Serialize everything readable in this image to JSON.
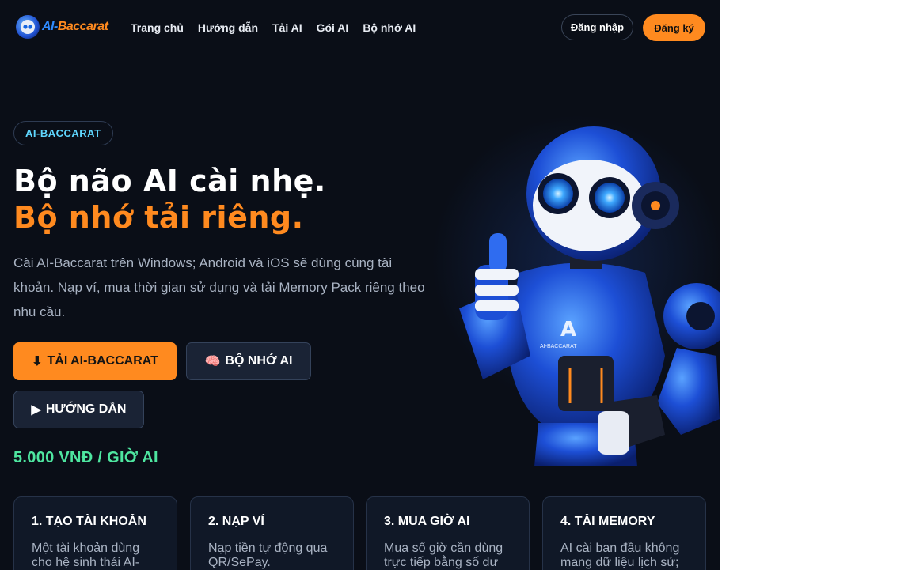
{
  "brand": {
    "logo_text": "AI-Baccarat",
    "accent": "#ff8a1f",
    "primary": "#2f8bff"
  },
  "nav": {
    "items": [
      "Trang chủ",
      "Hướng dẫn",
      "Tải AI",
      "Gói AI",
      "Bộ nhớ AI"
    ],
    "login": "Đăng nhập",
    "register": "Đăng ký"
  },
  "hero": {
    "pill": "AI-BACCARAT",
    "title_line1": "Bộ não AI cài nhẹ.",
    "title_line2": "Bộ nhớ tải riêng.",
    "description": "Cài AI-Baccarat trên Windows; Android và iOS sẽ dùng cùng tài khoản. Nạp ví, mua thời gian sử dụng và tải Memory Pack riêng theo nhu cầu.",
    "buttons": {
      "download": {
        "icon": "⬇",
        "label": "TẢI AI-BACCARAT"
      },
      "memory": {
        "icon": "🧠",
        "label": "BỘ NHỚ AI"
      },
      "guide": {
        "icon": "▶",
        "label": "HƯỚNG DẪN"
      }
    },
    "price": "5.000 VNĐ / GIỜ AI",
    "robot_chest_label": "AI-BACCARAT"
  },
  "steps": [
    {
      "title": "1. TẠO TÀI KHOẢN",
      "text": "Một tài khoản dùng cho hệ sinh thái AI-"
    },
    {
      "title": "2. NẠP VÍ",
      "text": "Nạp tiền tự động qua QR/SePay."
    },
    {
      "title": "3. MUA GIỜ AI",
      "text": "Mua số giờ cần dùng trực tiếp bằng số dư"
    },
    {
      "title": "4. TẢI MEMORY",
      "text": "AI cài ban đầu không mang dữ liệu lịch sử;"
    }
  ],
  "colors": {
    "background": "#0a0e17",
    "price": "#4ee6a0",
    "pill_text": "#5fd7ff"
  }
}
